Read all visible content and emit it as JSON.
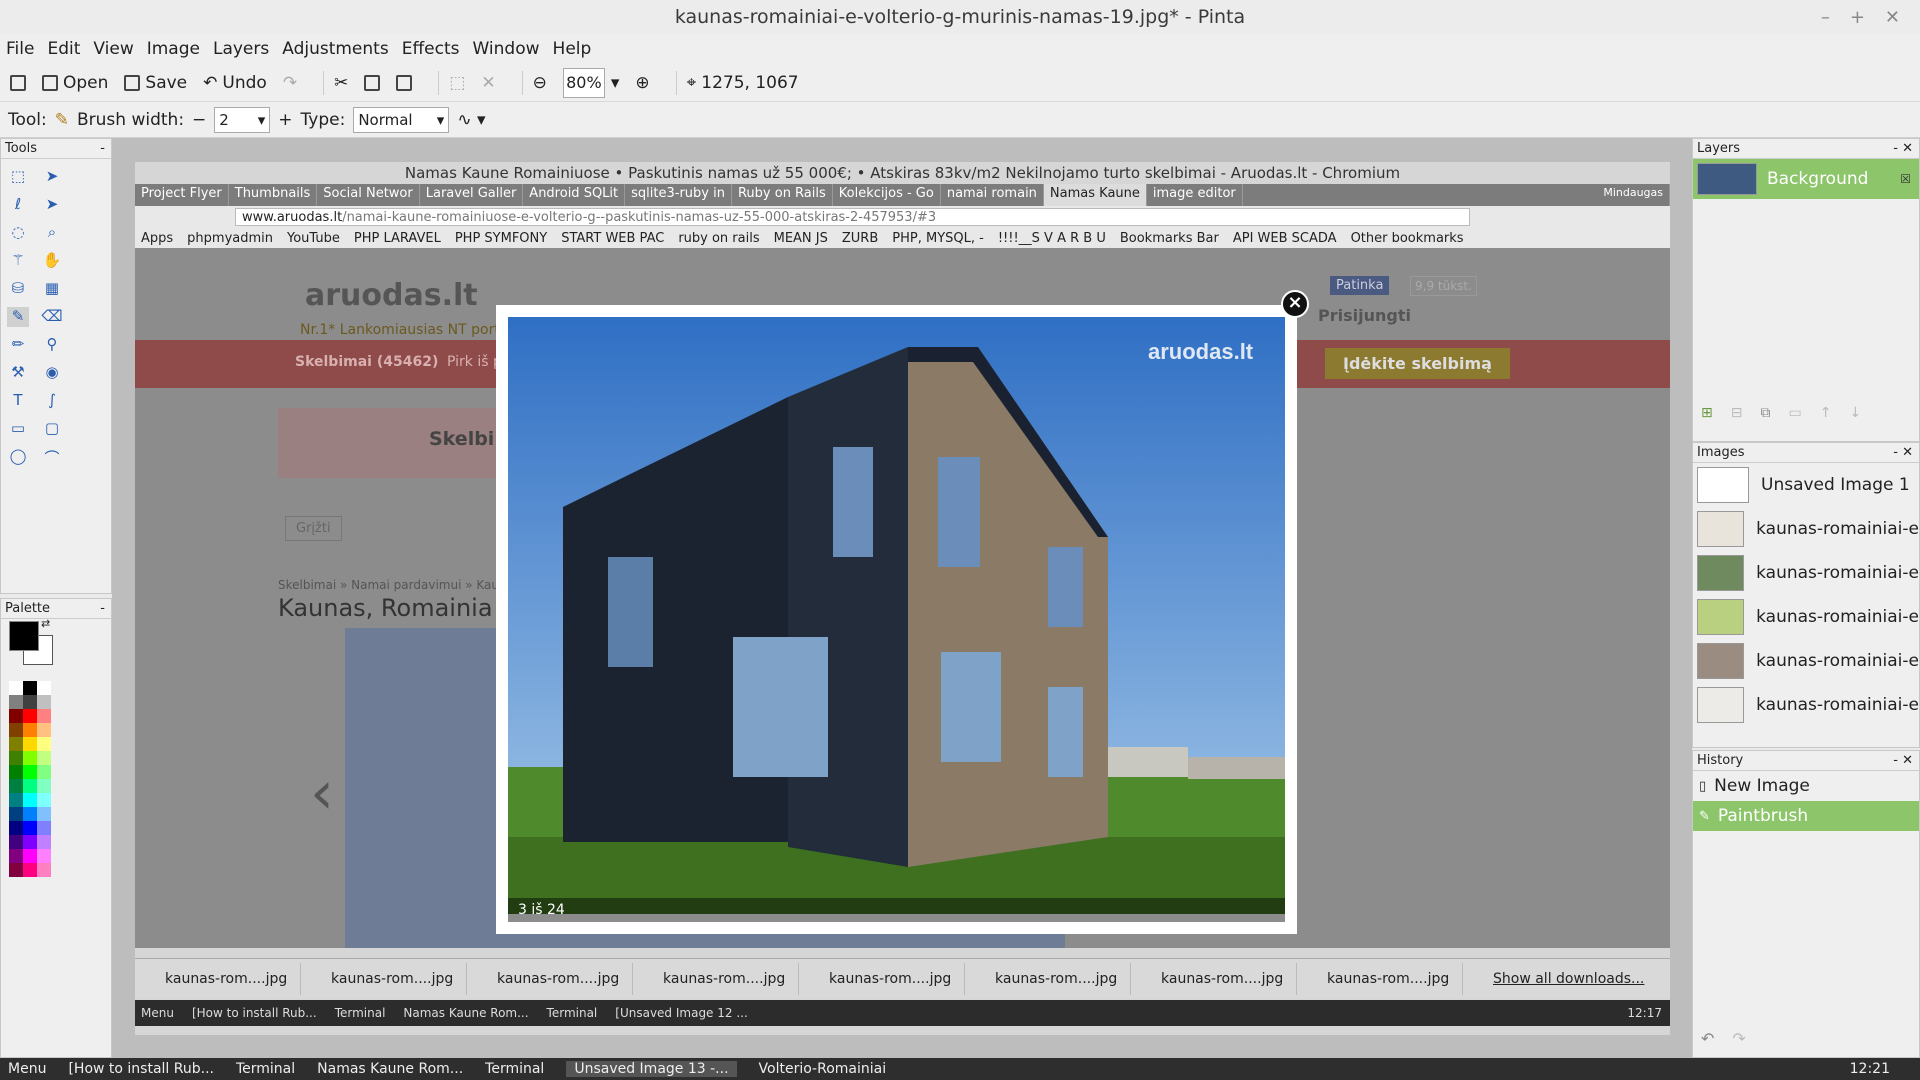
{
  "window": {
    "title": "kaunas-romainiai-e-volterio-g-murinis-namas-19.jpg* - Pinta"
  },
  "menu": [
    "File",
    "Edit",
    "View",
    "Image",
    "Layers",
    "Adjustments",
    "Effects",
    "Window",
    "Help"
  ],
  "toolbar": {
    "open": "Open",
    "save": "Save",
    "undo": "Undo",
    "zoom": "80%",
    "coords": "1275, 1067"
  },
  "tooloptions": {
    "tool_label": "Tool:",
    "brush_label": "Brush width:",
    "brush_value": "2",
    "type_label": "Type:",
    "type_value": "Normal"
  },
  "panels": {
    "tools": "Tools",
    "palette": "Palette",
    "layers": "Layers",
    "images": "Images",
    "history": "History"
  },
  "layers": [
    {
      "name": "Background"
    }
  ],
  "images": [
    "Unsaved Image 1",
    "kaunas-romainiai-e",
    "kaunas-romainiai-e",
    "kaunas-romainiai-e",
    "kaunas-romainiai-e",
    "kaunas-romainiai-e"
  ],
  "history": [
    {
      "label": "New Image"
    },
    {
      "label": "Paintbrush"
    }
  ],
  "browser": {
    "title": "Namas Kaune Romainiuose • Paskutinis namas už 55 000€; • Atskiras 83kv/m2 Nekilnojamo turto skelbimai - Aruodas.lt - Chromium",
    "tabs": [
      "Project Flyer",
      "Thumbnails",
      "Social Networ",
      "Laravel Galler",
      "Android SQLit",
      "sqlite3-ruby in",
      "Ruby on Rails",
      "Kolekcijos - Go",
      "namai romain",
      "Namas Kaune",
      "image editor"
    ],
    "tab_user": "Mindaugas",
    "url_host": "www.aruodas.lt",
    "url_path": "/namai-kaune-romainiuose-e-volterio-g--paskutinis-namas-uz-55-000-atskiras-2-457953/#3",
    "bookmarks": [
      "Apps",
      "phpmyadmin",
      "YouTube",
      "PHP LARAVEL",
      "PHP SYMFONY",
      "START WEB PAC",
      "ruby on rails",
      "MEAN JS",
      "ZURB",
      "PHP, MYSQL, -",
      "!!!!__S V A R B U",
      "Bookmarks Bar",
      "API WEB SCADA",
      "Other bookmarks"
    ],
    "page": {
      "logo": "aruodas.lt",
      "tagline": "Nr.1* Lankomiausias NT portal",
      "like": "Patinka",
      "like_count": "9,9 tūkst.",
      "login": "Prisijungti",
      "nav_ads": "Skelbimai (45462)",
      "nav_buy": "Pirk iš p",
      "post_ad": "Įdėkite skelbimą",
      "section": "Skelbi",
      "back": "Grįžti",
      "breadcrumb": "Skelbimai » Namai pardavimui » Kau",
      "heading": "Kaunas, Romainia"
    },
    "modal": {
      "caption": "3 iš 24",
      "watermark": "aruodas.lt"
    },
    "downloads": [
      "kaunas-rom....jpg",
      "kaunas-rom....jpg",
      "kaunas-rom....jpg",
      "kaunas-rom....jpg",
      "kaunas-rom....jpg",
      "kaunas-rom....jpg",
      "kaunas-rom....jpg",
      "kaunas-rom....jpg"
    ],
    "show_all": "Show all downloads...",
    "inner_taskbar": [
      "Menu",
      "[How to install Rub...",
      "Terminal",
      "Namas Kaune Rom...",
      "Terminal",
      "[Unsaved Image 12 ..."
    ],
    "inner_clock": "12:17"
  },
  "taskbar": {
    "items": [
      "Menu",
      "[How to install Rub...",
      "Terminal",
      "Namas Kaune Rom...",
      "Terminal",
      "Unsaved Image 13 -...",
      "Volterio-Romainiai"
    ],
    "clock": "12:21"
  },
  "colors": {
    "primary": "#000000",
    "secondary": "#ffffff",
    "history_selected": "#8dc56b"
  }
}
